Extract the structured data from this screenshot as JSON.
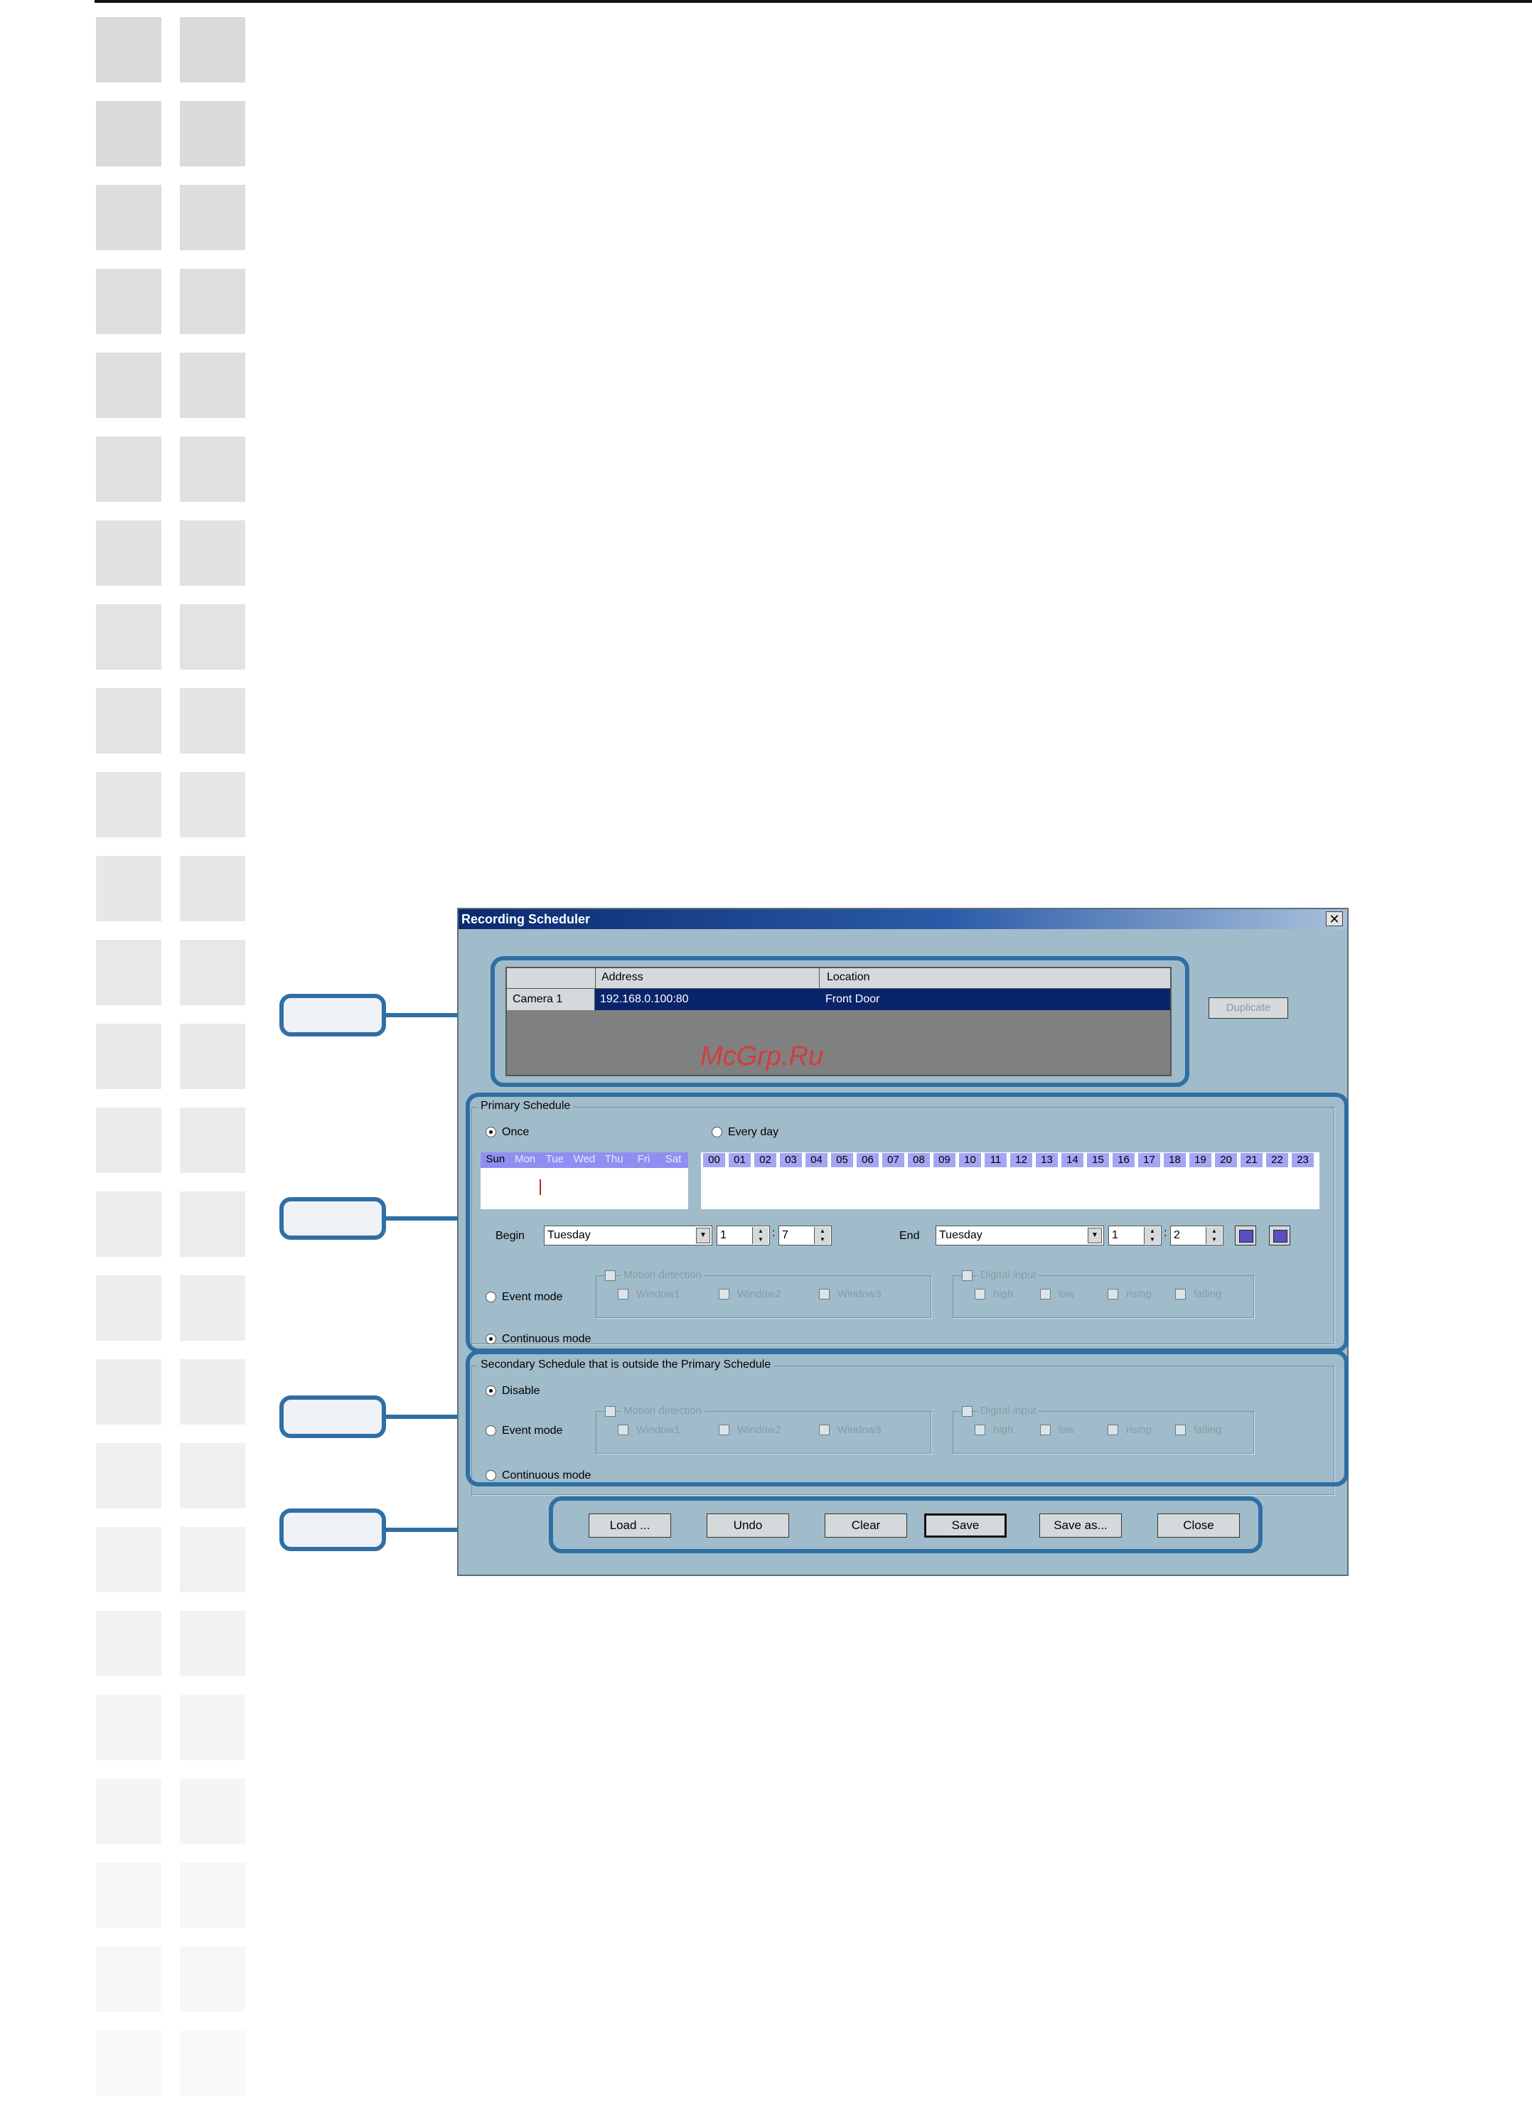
{
  "watermark": "McGrp.Ru",
  "dialog": {
    "title": "Recording Scheduler",
    "close_glyph": "✕",
    "table": {
      "headers": [
        "",
        "Address",
        "Location"
      ],
      "rows": [
        {
          "name": "Camera  1",
          "address": "192.168.0.100:80",
          "location": "Front Door"
        }
      ]
    },
    "duplicate_label": "Duplicate",
    "primary": {
      "title": "Primary Schedule",
      "once_label": "Once",
      "everyday_label": "Every day",
      "days": [
        "Sun",
        "Mon",
        "Tue",
        "Wed",
        "Thu",
        "Fri",
        "Sat"
      ],
      "hours": [
        "00",
        "01",
        "02",
        "03",
        "04",
        "05",
        "06",
        "07",
        "08",
        "09",
        "10",
        "11",
        "12",
        "13",
        "14",
        "15",
        "16",
        "17",
        "18",
        "19",
        "20",
        "21",
        "22",
        "23"
      ],
      "begin_label": "Begin",
      "begin_day": "Tuesday",
      "begin_hour": "1",
      "begin_min": "7",
      "end_label": "End",
      "end_day": "Tuesday",
      "end_hour": "1",
      "end_min": "2",
      "event_mode_label": "Event mode",
      "continuous_mode_label": "Continuous mode",
      "motion_label": "Motion detection",
      "windows": [
        "Window1",
        "Window2",
        "Window3"
      ],
      "digital_label": "Digital input",
      "digital_opts": [
        "high",
        "low",
        "rising",
        "falling"
      ]
    },
    "secondary": {
      "title": "Secondary Schedule that is outside the Primary Schedule",
      "disable_label": "Disable",
      "event_mode_label": "Event mode",
      "continuous_mode_label": "Continuous mode",
      "motion_label": "Motion detection",
      "windows": [
        "Window1",
        "Window2",
        "Window3"
      ],
      "digital_label": "Digital input",
      "digital_opts": [
        "high",
        "low",
        "rising",
        "falling"
      ]
    },
    "buttons": [
      "Load ...",
      "Undo",
      "Clear",
      "Save",
      "Save as...",
      "Close"
    ]
  },
  "colors": {
    "dialog_bg": "#a0bccb",
    "highlight": "#2f6fa3",
    "selected_row": "#0a246a",
    "day_strip": "#8f8ff2"
  }
}
